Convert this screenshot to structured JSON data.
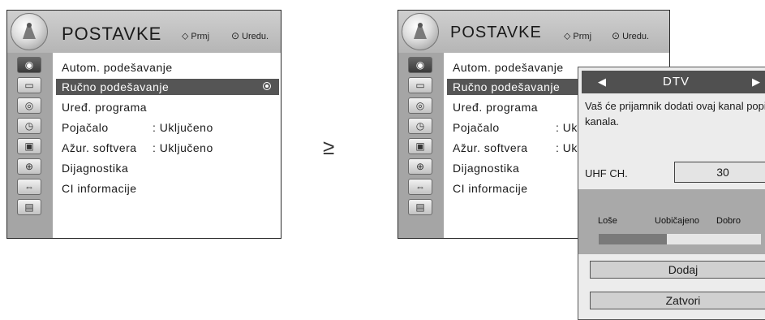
{
  "transition_arrow": "≥",
  "left_screen": {
    "title": "POSTAVKE",
    "hints": {
      "move": "Prmj",
      "ok": "Uredu."
    },
    "menu": [
      {
        "label": "Autom. podešavanje",
        "value": ""
      },
      {
        "label": "Ručno podešavanje",
        "value": "",
        "selected": true
      },
      {
        "label": "Uređ. programa",
        "value": ""
      },
      {
        "label": "Pojačalo",
        "value": ": Uključeno"
      },
      {
        "label": "Ažur. softvera",
        "value": ": Uključeno"
      },
      {
        "label": "Dijagnostika",
        "value": ""
      },
      {
        "label": "CI informacije",
        "value": ""
      }
    ]
  },
  "right_screen": {
    "title": "POSTAVKE",
    "hints": {
      "move": "Prmj",
      "ok": "Uredu."
    },
    "menu": [
      {
        "label": "Autom. podešavanje",
        "value": ""
      },
      {
        "label": "Ručno podešavanje",
        "value": "",
        "selected": true
      },
      {
        "label": "Uređ. programa",
        "value": ""
      },
      {
        "label": "Pojačalo",
        "value": ": Uklj"
      },
      {
        "label": "Ažur. softvera",
        "value": ": Uklj"
      },
      {
        "label": "Dijagnostika",
        "value": ""
      },
      {
        "label": "CI informacije",
        "value": ""
      }
    ],
    "popup": {
      "mode": "DTV",
      "message": "Vaš će prijamnik dodati ovaj kanal popisu kanala.",
      "uhf_label": "UHF CH.",
      "uhf_value": "30",
      "signal_labels": [
        "Loše",
        "Uobičajeno",
        "Dobro"
      ],
      "signal_level": 0.42,
      "buttons": {
        "add": "Dodaj",
        "close": "Zatvori"
      }
    }
  },
  "sidebar_icons": [
    "antenna-icon",
    "picture-icon",
    "audio-icon",
    "clock-icon",
    "lock-icon",
    "option-icon",
    "input-icon",
    "usb-icon"
  ],
  "colors": {
    "selected_row": "#555555",
    "header": "#c2c2c2",
    "sidebar": "#a5a5a5",
    "popup_header": "#505050",
    "signal_panel": "#a9a9a9"
  }
}
